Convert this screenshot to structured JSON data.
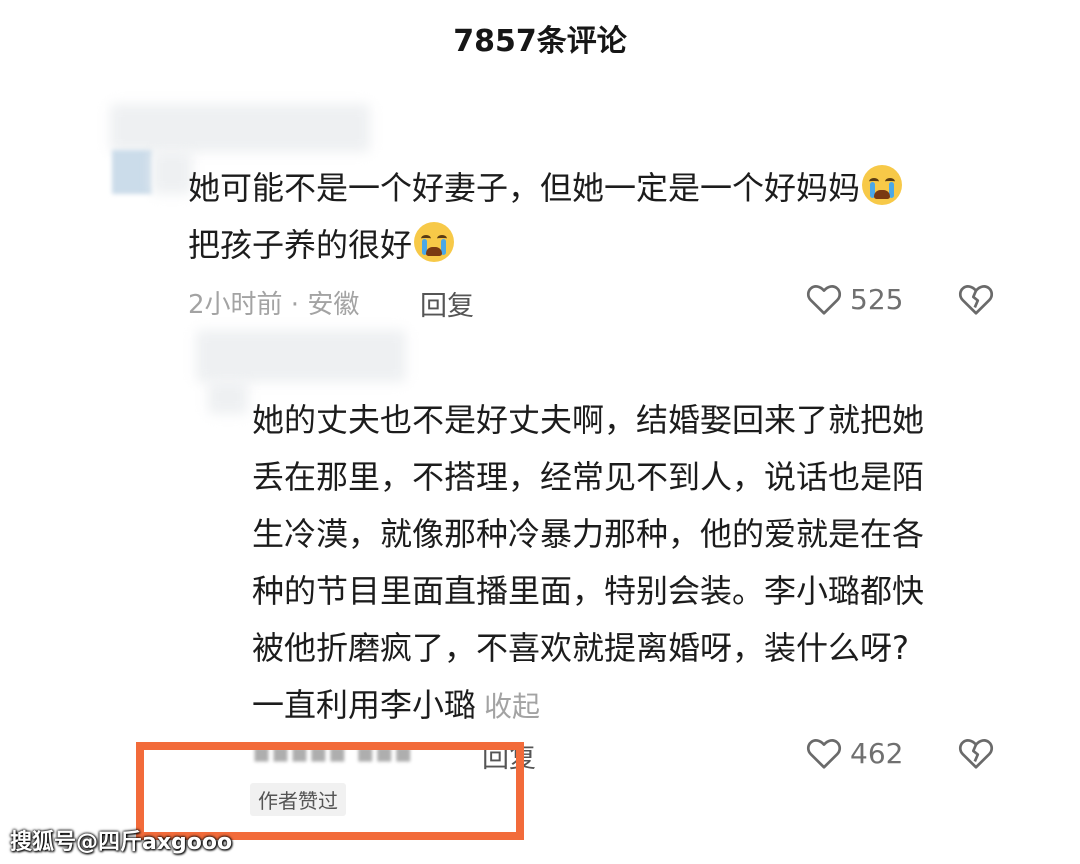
{
  "header": {
    "title": "7857条评论"
  },
  "comments": [
    {
      "text_line1": "她可能不是一个好妻子，但她一定是一个好妈妈",
      "text_line2": "把孩子养的很好",
      "emoji": "loudly-crying-face",
      "meta": "2小时前 · 安徽",
      "reply_label": "回复",
      "likes": "525"
    },
    {
      "lines": [
        "她的丈夫也不是好丈夫啊，结婚娶回来了就把她",
        "丢在那里，不搭理，经常见不到人，说话也是陌",
        "生冷漠，就像那种冷暴力那种，他的爱就是在各",
        "种的节目里面直播里面，特别会装。李小璐都快",
        "被他折磨疯了，不喜欢就提离婚呀，装什么呀?"
      ],
      "last_line": "一直利用李小璐",
      "collapse_label": "收起",
      "reply_label": "回复",
      "likes": "462",
      "author_tag": "作者赞过"
    }
  ],
  "watermark": "搜狐号@四斤axgooo",
  "colors": {
    "highlight": "#f26b3a",
    "muted": "#a3a3a3"
  }
}
